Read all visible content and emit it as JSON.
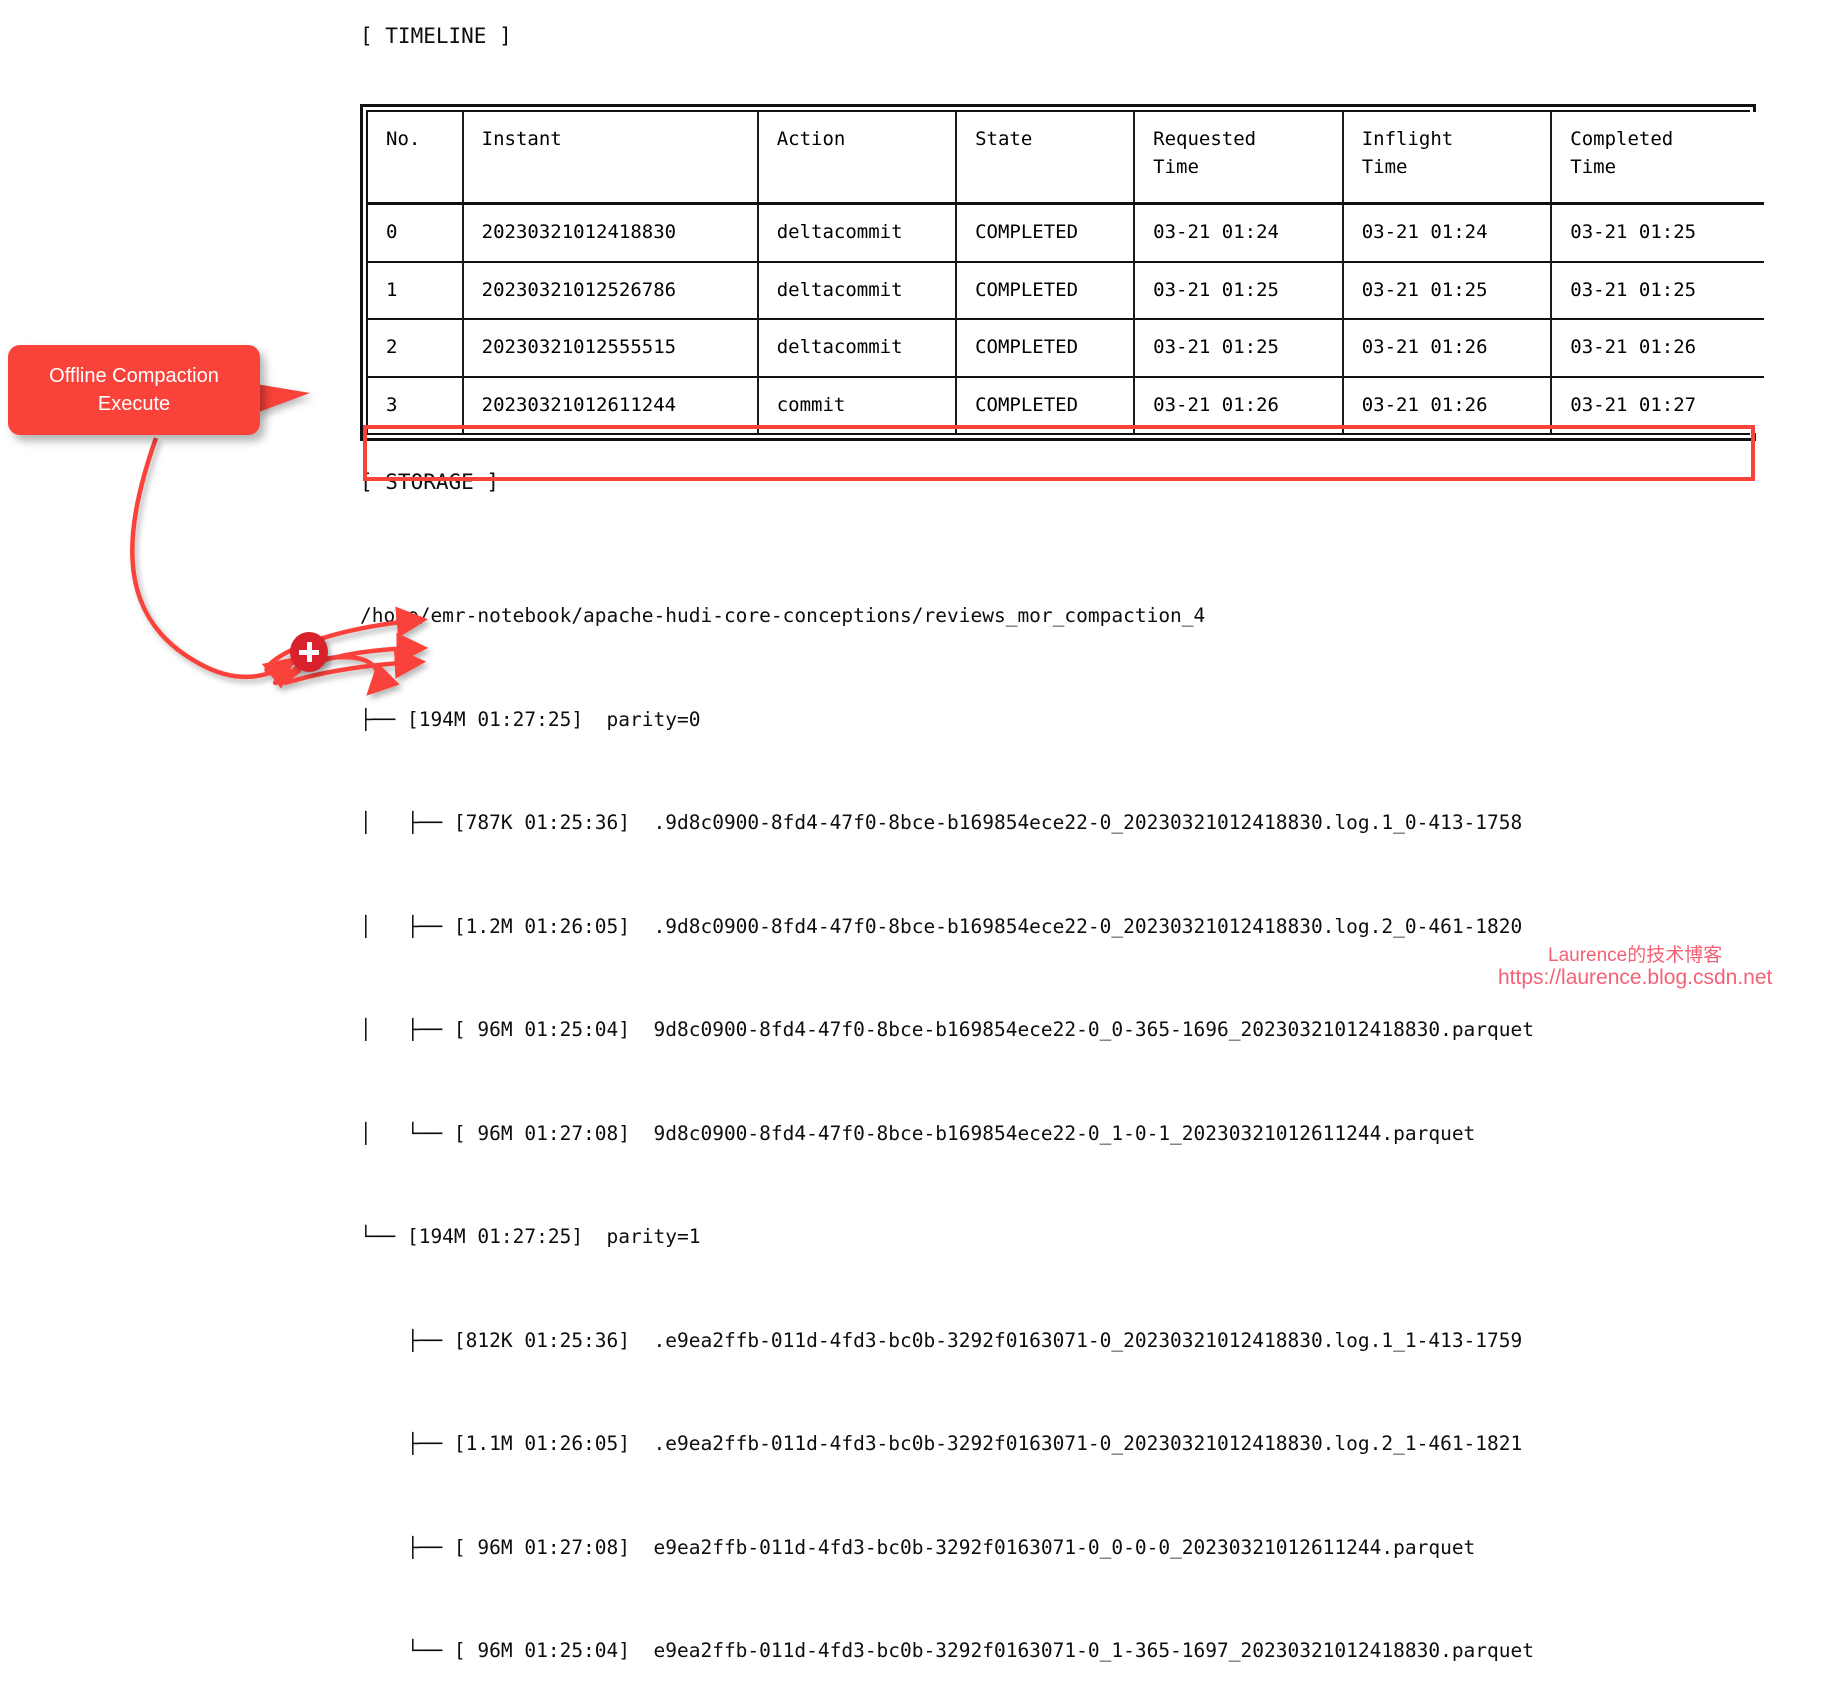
{
  "headings": {
    "timeline": "[ TIMELINE ]",
    "storage": "[ STORAGE ]"
  },
  "colors": {
    "accent_red": "#f9423a",
    "badge_red": "#d8212a",
    "watermark_pink": "#f4546a",
    "text": "#0d0d0d"
  },
  "callout": {
    "label": "Offline Compaction\nExecute"
  },
  "timeline_table": {
    "columns": [
      "No.",
      "Instant",
      "Action",
      "State",
      "Requested\nTime",
      "Inflight\nTime",
      "Completed\nTime"
    ],
    "rows": [
      {
        "no": "0",
        "instant": "20230321012418830",
        "action": "deltacommit",
        "state": "COMPLETED",
        "requested_time": "03-21 01:24",
        "inflight_time": "03-21 01:24",
        "completed_time": "03-21 01:25",
        "highlighted": false
      },
      {
        "no": "1",
        "instant": "20230321012526786",
        "action": "deltacommit",
        "state": "COMPLETED",
        "requested_time": "03-21 01:25",
        "inflight_time": "03-21 01:25",
        "completed_time": "03-21 01:25",
        "highlighted": false
      },
      {
        "no": "2",
        "instant": "20230321012555515",
        "action": "deltacommit",
        "state": "COMPLETED",
        "requested_time": "03-21 01:25",
        "inflight_time": "03-21 01:26",
        "completed_time": "03-21 01:26",
        "highlighted": false
      },
      {
        "no": "3",
        "instant": "20230321012611244",
        "action": "commit",
        "state": "COMPLETED",
        "requested_time": "03-21 01:26",
        "inflight_time": "03-21 01:26",
        "completed_time": "03-21 01:27",
        "highlighted": true
      }
    ]
  },
  "storage": {
    "root_path": "/home/emr-notebook/apache-hudi-core-conceptions/reviews_mor_compaction_4",
    "lines": [
      "├── [194M 01:27:25]  parity=0",
      "│   ├── [787K 01:25:36]  .9d8c0900-8fd4-47f0-8bce-b169854ece22-0_20230321012418830.log.1_0-413-1758",
      "│   ├── [1.2M 01:26:05]  .9d8c0900-8fd4-47f0-8bce-b169854ece22-0_20230321012418830.log.2_0-461-1820",
      "│   ├── [ 96M 01:25:04]  9d8c0900-8fd4-47f0-8bce-b169854ece22-0_0-365-1696_20230321012418830.parquet",
      "│   └── [ 96M 01:27:08]  9d8c0900-8fd4-47f0-8bce-b169854ece22-0_1-0-1_20230321012611244.parquet",
      "└── [194M 01:27:25]  parity=1",
      "    ├── [812K 01:25:36]  .e9ea2ffb-011d-4fd3-bc0b-3292f0163071-0_20230321012418830.log.1_1-413-1759",
      "    ├── [1.1M 01:26:05]  .e9ea2ffb-011d-4fd3-bc0b-3292f0163071-0_20230321012418830.log.2_1-461-1821",
      "    ├── [ 96M 01:27:08]  e9ea2ffb-011d-4fd3-bc0b-3292f0163071-0_0-0-0_20230321012611244.parquet",
      "    └── [ 96M 01:25:04]  e9ea2ffb-011d-4fd3-bc0b-3292f0163071-0_1-365-1697_20230321012418830.parquet"
    ]
  },
  "watermark": {
    "title": "Laurence的技术博客",
    "url": "https://laurence.blog.csdn.net"
  }
}
